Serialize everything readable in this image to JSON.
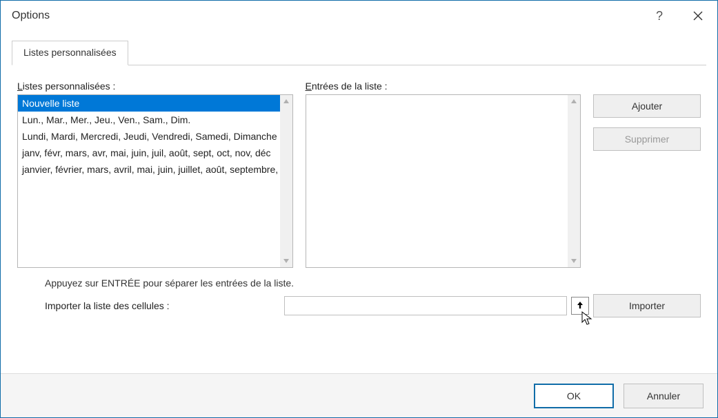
{
  "title": "Options",
  "tab": {
    "label": "Listes personnalisées"
  },
  "left": {
    "label_prefix": "L",
    "label_rest": "istes personnalisées :",
    "items": [
      "Nouvelle liste",
      "Lun., Mar., Mer., Jeu., Ven., Sam., Dim.",
      "Lundi, Mardi, Mercredi, Jeudi, Vendredi, Samedi, Dimanche",
      "janv, févr, mars, avr, mai, juin, juil, août, sept, oct, nov, déc",
      "janvier, février, mars, avril, mai, juin, juillet, août, septembre, octobre, novembre, décembre"
    ],
    "selected_index": 0
  },
  "mid": {
    "label_prefix": "E",
    "label_rest": "ntrées de la liste :",
    "value": ""
  },
  "buttons": {
    "add": "Ajouter",
    "delete": "Supprimer",
    "import": "Importer"
  },
  "help_text": "Appuyez sur ENTRÉE pour séparer les entrées de la liste.",
  "import_row": {
    "label_prefix": "I",
    "label_rest": "mporter la liste des cellules :",
    "value": ""
  },
  "footer": {
    "ok": "OK",
    "cancel": "Annuler"
  }
}
